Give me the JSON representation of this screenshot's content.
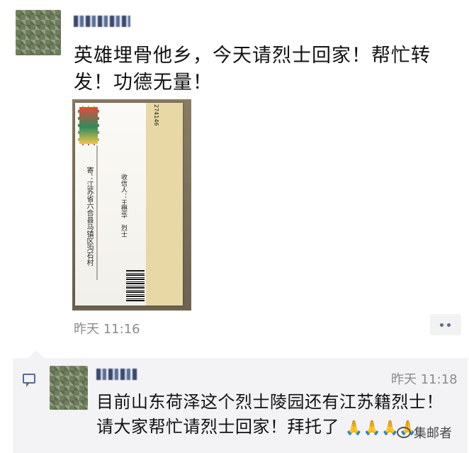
{
  "post": {
    "text_line1": "英雄埋骨他乡，今天请烈士回家！帮忙转",
    "text_line2": "发！功德无量！",
    "timestamp": "昨天 11:16",
    "envelope": {
      "recipient_address": "寄：江苏省六合县马镇区沟石村",
      "recipient_name": "收信人：王懋华　烈士",
      "serial": "274146"
    }
  },
  "comment": {
    "timestamp": "昨天 11:18",
    "text_line1": "目前山东荷泽这个烈士陵园还有江苏籍烈士！",
    "text_line2": "请大家帮忙请烈士回家！拜托了",
    "emoji": "🙏🙏🙏🙏"
  },
  "watermark": {
    "text": "集邮者"
  },
  "icons": {
    "comment": "comment-icon",
    "more": "more-dots-icon"
  },
  "colors": {
    "link_blue": "#576b95",
    "timestamp_gray": "#8b8b8b",
    "comment_bg": "#f3f3f5"
  }
}
